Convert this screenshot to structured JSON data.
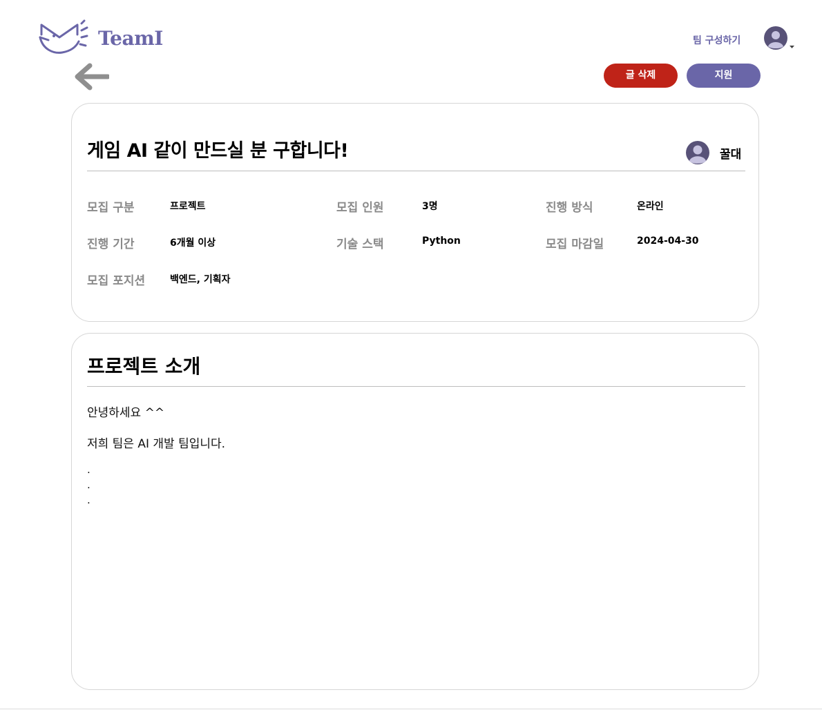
{
  "header": {
    "logo_text": "TeamI",
    "nav_team_build": "팀 구성하기",
    "icons": {
      "logo": "cat-mail-logo",
      "avatar": "user-avatar-icon",
      "dropdown": "caret-down-icon",
      "back": "arrow-left-icon"
    },
    "brand_color": "#6a66a8"
  },
  "actions": {
    "delete_label": "글 삭제",
    "apply_label": "지원",
    "delete_color": "#bf2318",
    "apply_color": "#6a66a8"
  },
  "post": {
    "title": "게임 AI 같이 만드실 분 구합니다!",
    "author": "꿀대",
    "info": [
      {
        "label": "모집 구분",
        "value": "프로젝트"
      },
      {
        "label": "모집 인원",
        "value": "3명"
      },
      {
        "label": "진행 방식",
        "value": "온라인"
      },
      {
        "label": "진행 기간",
        "value": "6개월 이상"
      },
      {
        "label": "기술 스택",
        "value": "Python"
      },
      {
        "label": "모집 마감일",
        "value": "2024-04-30"
      },
      {
        "label": "모집 포지션",
        "value": "백엔드, 기획자"
      }
    ]
  },
  "intro": {
    "title": "프로젝트 소개",
    "lines": [
      "안녕하세요 ^^",
      "저희 팀은 AI 개발 팀입니다."
    ],
    "dots": [
      ".",
      ".",
      "."
    ]
  }
}
